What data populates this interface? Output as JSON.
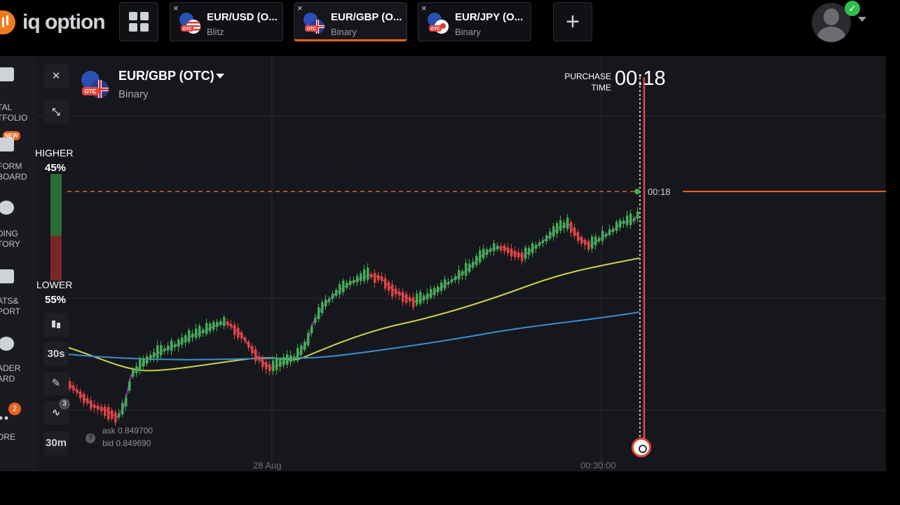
{
  "brand": {
    "logo_text": "iq option"
  },
  "topbar": {
    "tabs": [
      {
        "title": "EUR/USD (O...",
        "type": "Blitz",
        "active": false
      },
      {
        "title": "EUR/GBP (O...",
        "type": "Binary",
        "active": true
      },
      {
        "title": "EUR/JPY (O...",
        "type": "Binary",
        "active": false
      }
    ],
    "close_symbol": "×",
    "add_symbol": "+",
    "grid_icon": "grid-icon",
    "account_status": "verified"
  },
  "sidebar": {
    "items": [
      {
        "label": "TAL\nTFOLIO",
        "icon": "portfolio-icon"
      },
      {
        "label": "FORM\nBOARD",
        "icon": "board-icon",
        "badge": "NEW"
      },
      {
        "label": "DING\nTORY",
        "icon": "history-icon"
      },
      {
        "label": "ATS&\nPORT",
        "icon": "chat-icon"
      },
      {
        "label": "ADER\nARD",
        "icon": "leaderboard-icon"
      },
      {
        "label": "ORE",
        "icon": "more-icon",
        "badge": "2"
      }
    ]
  },
  "chart_header": {
    "asset": "EUR/GBP (OTC)",
    "asset_type": "Binary",
    "purchase_label_1": "PURCHASE",
    "purchase_label_2": "TIME",
    "purchase_time": "00:18"
  },
  "sentiment": {
    "higher_label": "HIGHER",
    "higher_pct": "45%",
    "lower_label": "LOWER",
    "lower_pct": "55%"
  },
  "controls": {
    "timeframe": "30s",
    "badge_count": "3",
    "period": "30m"
  },
  "quotes": {
    "ask": "ask 0.849700",
    "bid": "bid 0.849690",
    "info": "?"
  },
  "xaxis": {
    "date_label": "28 Aug",
    "time_label": "00:30:00"
  },
  "price_line_time": "00:18",
  "colors": {
    "up": "#3fb04f",
    "down": "#e0443a",
    "accent": "#e8621f",
    "ma_fast": "#cfd04a",
    "ma_slow": "#3b8fd4",
    "trend": "#8a2fb5"
  }
}
